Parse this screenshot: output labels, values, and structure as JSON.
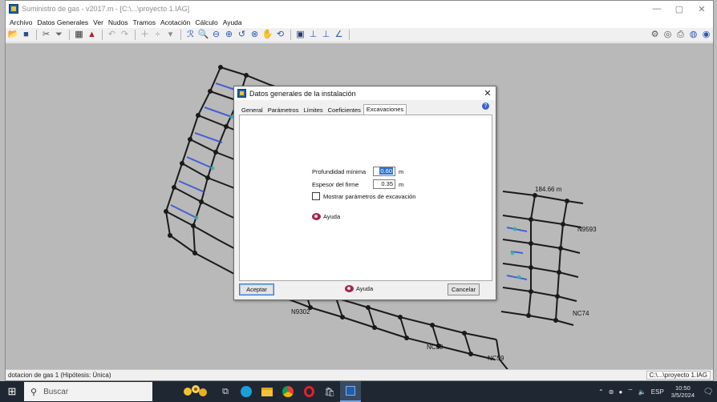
{
  "window": {
    "title": "Suministro de gas - v2017.m - [C:\\...\\proyecto 1.IAG]",
    "controls": [
      "—",
      "▢",
      "✕"
    ]
  },
  "menu": [
    "Archivo",
    "Datos Generales",
    "Ver",
    "Nudos",
    "Tramos",
    "Acotación",
    "Cálculo",
    "Ayuda"
  ],
  "canvas": {
    "labels": {
      "dim_184": "184.66 m",
      "n1": "N9302",
      "n2": "NC59",
      "n3": "NC74",
      "n4": "N9593",
      "n5": "NC59"
    }
  },
  "dialog": {
    "title": "Datos generales de la instalación",
    "close": "✕",
    "help_badge": "?",
    "tabs": [
      "General",
      "Parámetros",
      "Límites",
      "Coeficientes",
      "Excavaciones"
    ],
    "active_tab": 4,
    "fields": {
      "profundidad": {
        "label": "Profundidad mínima",
        "value": "0.60",
        "unit": "m"
      },
      "espesor": {
        "label": "Espesor del firme",
        "value": "0.35",
        "unit": "m"
      },
      "mostrar": {
        "label": "Mostrar parámetros de excavación",
        "checked": false
      }
    },
    "panel_help": "Ayuda",
    "buttons": {
      "accept": "Aceptar",
      "help": "Ayuda",
      "cancel": "Cancelar"
    }
  },
  "status": {
    "left": "dotacion de gas 1 (Hipótesis: Única)",
    "right": "C:\\...\\proyecto 1.IAG"
  },
  "taskbar": {
    "search_placeholder": "Buscar",
    "tray_lang": "ESP",
    "time": "10:50",
    "date": "3/5/2024"
  }
}
